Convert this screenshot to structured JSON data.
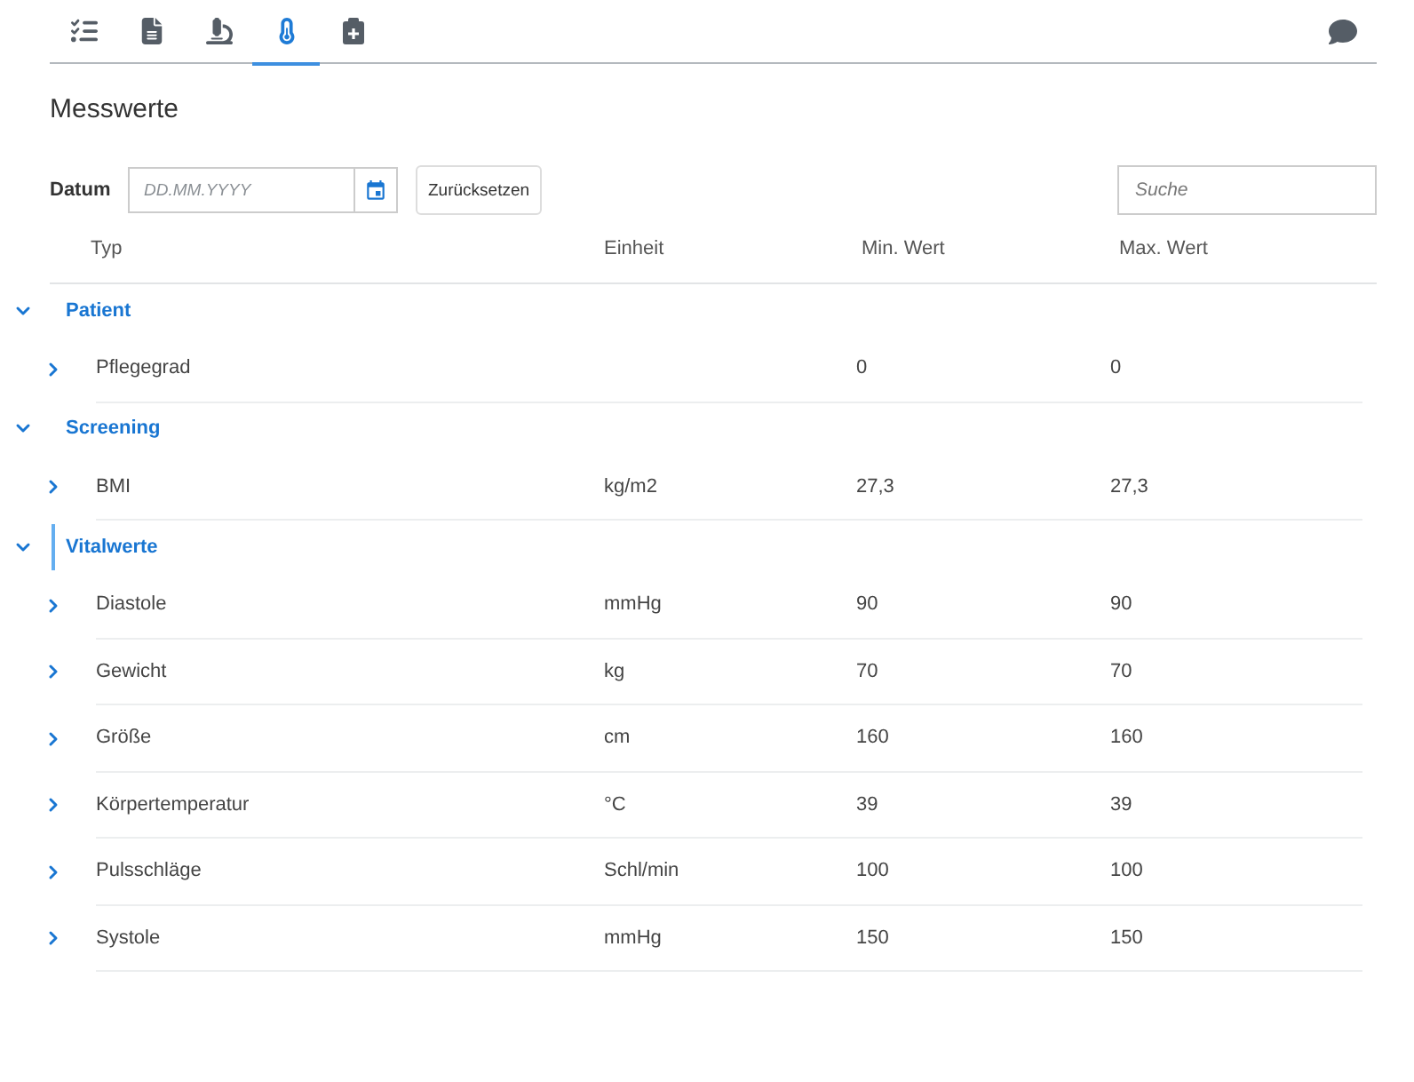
{
  "tabs": [
    {
      "kind": "checklist",
      "selected": false
    },
    {
      "kind": "document",
      "selected": false
    },
    {
      "kind": "microscope",
      "selected": false
    },
    {
      "kind": "thermometer",
      "selected": true
    },
    {
      "kind": "clipboard",
      "selected": false
    }
  ],
  "title": "Messwerte",
  "date_field": {
    "label": "Datum",
    "placeholder": "DD.MM.YYYY"
  },
  "reset_button": "Zurücksetzen",
  "search": {
    "placeholder": "Suche"
  },
  "table": {
    "columns": [
      "Typ",
      "Einheit",
      "Min. Wert",
      "Max. Wert"
    ],
    "groups": [
      {
        "label": "Patient",
        "expanded": true,
        "focused": false,
        "rows": [
          {
            "type": "Pflegegrad",
            "min": "0",
            "max": "0",
            "expanded": false
          }
        ]
      },
      {
        "label": "Screening",
        "expanded": true,
        "focused": false,
        "rows": [
          {
            "type": "BMI",
            "unit": "kg/m2",
            "min": "27,3",
            "max": "27,3",
            "expanded": false
          }
        ]
      },
      {
        "label": "Vitalwerte",
        "expanded": true,
        "focused": true,
        "rows": [
          {
            "type": "Diastole",
            "unit": "mmHg",
            "min": "90",
            "max": "90",
            "expanded": false
          },
          {
            "type": "Gewicht",
            "unit": "kg",
            "min": "70",
            "max": "70",
            "expanded": false
          },
          {
            "type": "Größe",
            "unit": "cm",
            "min": "160",
            "max": "160",
            "expanded": false
          },
          {
            "type": "Körpertemperatur",
            "unit": "°C",
            "min": "39",
            "max": "39",
            "expanded": false
          },
          {
            "type": "Pulsschläge",
            "unit": "Schl/min",
            "min": "100",
            "max": "100",
            "expanded": false
          },
          {
            "type": "Systole",
            "unit": "mmHg",
            "min": "150",
            "max": "150",
            "expanded": false
          }
        ]
      }
    ]
  }
}
